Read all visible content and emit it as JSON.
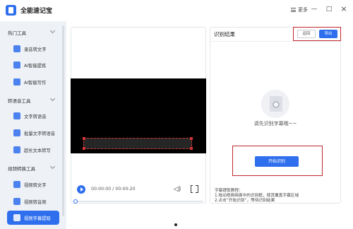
{
  "app": {
    "title": "全能速记宝"
  },
  "window": {
    "more_label": "更多",
    "minimize": "—",
    "maximize": "□",
    "close": "×"
  },
  "sidebar": {
    "sections": [
      {
        "label": "热门工具",
        "items": [
          {
            "label": "录音转文字"
          },
          {
            "label": "AI智能提炼"
          },
          {
            "label": "AI智能写作"
          }
        ]
      },
      {
        "label": "转语音工具",
        "items": [
          {
            "label": "文字转语音"
          },
          {
            "label": "批量文字转语音"
          },
          {
            "label": "超长文本转写"
          }
        ]
      },
      {
        "label": "视频转换工具",
        "items": [
          {
            "label": "视频转文字"
          },
          {
            "label": "视频转音频"
          },
          {
            "label": "视频字幕提取",
            "active": true
          }
        ]
      }
    ]
  },
  "player": {
    "time": "00:00:00 / 00:00:20",
    "progress": 0.0
  },
  "result": {
    "title": "识别结果",
    "return_label": "返回",
    "export_label": "导出",
    "empty_text": "请先识别字幕哦~~",
    "start_label": "开始识别",
    "tips_title": "字幕提取教程：",
    "tips": [
      "1.拖动视频画面中的识别框，使其覆盖字幕区域",
      "2.点击“开始识别”，等待识别结果"
    ]
  },
  "colors": {
    "accent": "#2f6fed",
    "highlight": "#c0272d",
    "sidebar_bg": "#eef1f6"
  }
}
